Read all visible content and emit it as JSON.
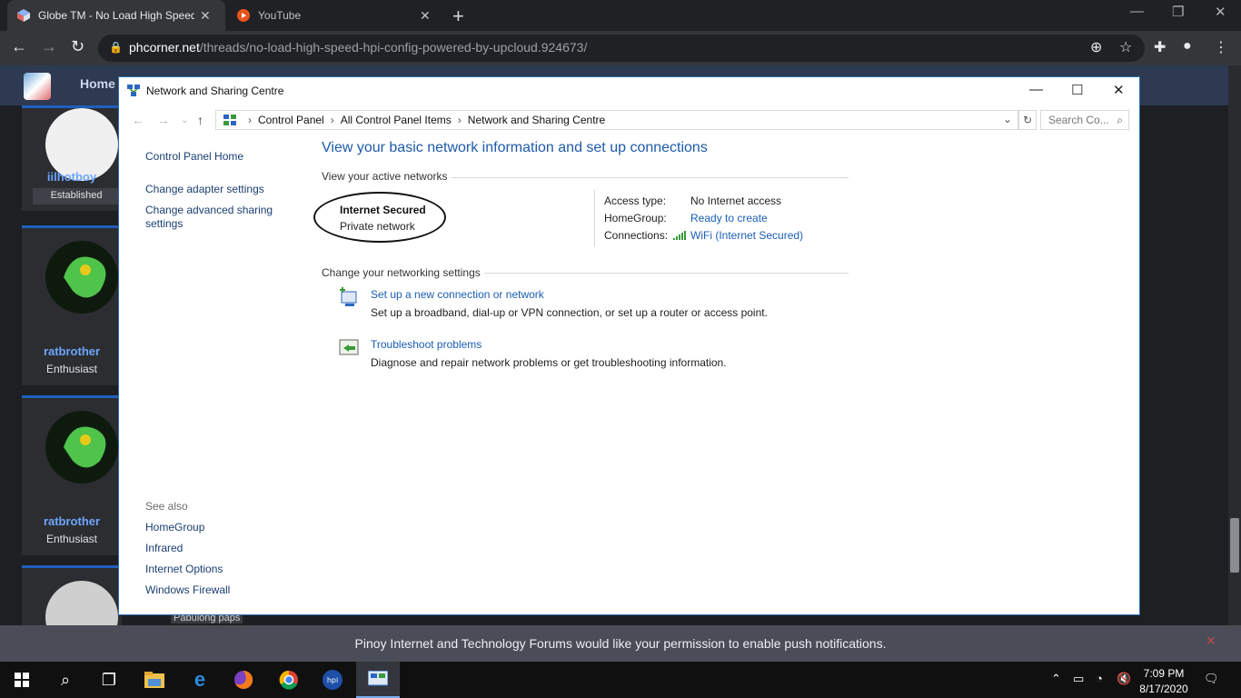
{
  "browser": {
    "tabs": [
      {
        "title": "Globe TM - No Load High Speed",
        "active": true
      },
      {
        "title": "YouTube",
        "active": false
      }
    ],
    "url_host": "phcorner.net",
    "url_path": "/threads/no-load-high-speed-hpi-config-powered-by-upcloud.924673/"
  },
  "site": {
    "nav_home": "Home",
    "posts": [
      {
        "name": "iilhotboy",
        "rank": "Established"
      },
      {
        "name": "ratbrother",
        "rank": "Enthusiast"
      },
      {
        "name": "ratbrother",
        "rank": "Enthusiast"
      }
    ],
    "partial_name": "Pabulong paps",
    "notification": "Pinoy Internet and Technology Forums would like your permission to enable push notifications."
  },
  "window": {
    "title": "Network and Sharing Centre",
    "breadcrumb": [
      "Control Panel",
      "All Control Panel Items",
      "Network and Sharing Centre"
    ],
    "search_placeholder": "Search Co...",
    "left_links": [
      "Control Panel Home",
      "Change adapter settings",
      "Change advanced sharing settings"
    ],
    "see_also_title": "See also",
    "see_also": [
      "HomeGroup",
      "Infrared",
      "Internet Options",
      "Windows Firewall"
    ],
    "heading": "View your basic network information and set up connections",
    "active_networks_title": "View your active networks",
    "network": {
      "name": "Internet Secured",
      "type": "Private network"
    },
    "details": {
      "access_type_label": "Access type:",
      "access_type_value": "No Internet access",
      "homegroup_label": "HomeGroup:",
      "homegroup_value": "Ready to create",
      "connections_label": "Connections:",
      "connections_value": "WiFi (Internet Secured)"
    },
    "change_settings_title": "Change your networking settings",
    "tasks": [
      {
        "link": "Set up a new connection or network",
        "desc": "Set up a broadband, dial-up or VPN connection, or set up a router or access point."
      },
      {
        "link": "Troubleshoot problems",
        "desc": "Diagnose and repair network problems or get troubleshooting information."
      }
    ]
  },
  "taskbar": {
    "time": "7:09 PM",
    "date": "8/17/2020",
    "icons": [
      "windows-start-icon",
      "search-icon",
      "task-view-icon",
      "file-explorer-icon",
      "edge-icon",
      "firefox-icon",
      "chrome-icon",
      "hpi-app-icon",
      "control-panel-icon"
    ]
  },
  "colors": {
    "link": "#1a5fb4",
    "heading": "#1e5aa8",
    "window_border": "#2a6fb6"
  }
}
